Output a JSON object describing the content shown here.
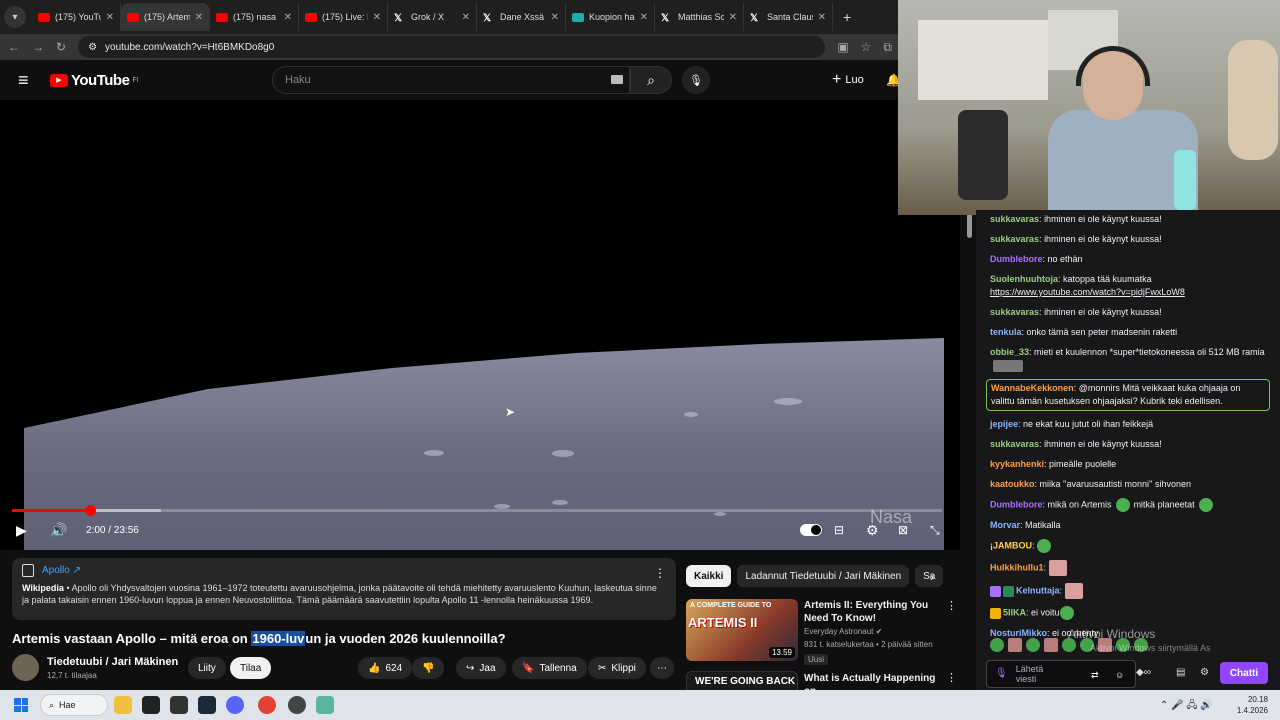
{
  "browser": {
    "tabs": [
      {
        "label": "(175) YouTu",
        "icon": "youtube-icon"
      },
      {
        "label": "(175) Artem",
        "icon": "youtube-icon",
        "active": true
      },
      {
        "label": "(175) nasa l",
        "icon": "youtube-icon"
      },
      {
        "label": "(175) Live: I",
        "icon": "youtube-icon"
      },
      {
        "label": "Grok / X",
        "icon": "x-icon"
      },
      {
        "label": "Dane Xssä",
        "icon": "x-icon"
      },
      {
        "label": "Kuopion ha",
        "icon": "kuopio-icon"
      },
      {
        "label": "Matthias Sc",
        "icon": "x-icon"
      },
      {
        "label": "Santa Claus",
        "icon": "x-icon"
      }
    ],
    "url": "youtube.com/watch?v=Ht6BMKDo8g0"
  },
  "youtube": {
    "logo_text": "YouTube",
    "region": "FI",
    "search_placeholder": "Haku",
    "create_label": "Luo"
  },
  "player": {
    "time": "2:00 / 23:56",
    "progress": 0.084,
    "buffered": 0.16,
    "watermark": "Nasa"
  },
  "info": {
    "title": "Apollo ↗",
    "source": "Wikipedia",
    "text": " • Apollo oli Yhdysvaltojen vuosina 1961–1972 toteutettu avaruusohjelma, jonka päätavoite oli tehdä miehitetty avaruuslento Kuuhun, laskeutua sinne ja palata takaisin ennen 1960-luvun loppua ja ennen Neuvostoliittoa. Tämä päämäärä saavutettiin lopulta Apollo 11 -lennolla heinäkuussa 1969."
  },
  "video": {
    "title_pre": "Artemis vastaan Apollo – mitä eroa on ",
    "title_hl": "1960-luv",
    "title_post": "un ja vuoden 2026 kuulennoilla?",
    "channel": "Tiedetuubi / Jari Mäkinen",
    "subscribers": "12,7 t. tilaajaa",
    "join": "Liity",
    "subscribe": "Tilaa",
    "likes": "624",
    "share": "Jaa",
    "save": "Tallenna",
    "clip": "Klippi"
  },
  "filters": [
    "Kaikki",
    "Ladannut Tiedetuubi / Jari Mäkinen",
    "Sa"
  ],
  "recommendations": [
    {
      "title": "Artemis II: Everything You Need To Know!",
      "channel": "Everyday Astronaut",
      "meta": "831 t. katselukertaa • 2 päivää sitten",
      "badge": "Uusi",
      "duration": "13.59",
      "thumb_top": "A COMPLETE GUIDE TO",
      "thumb_big": "ARTEMIS II"
    },
    {
      "title": "What is Actually Happening on",
      "thumb_text": "WE'RE GOING BACK"
    }
  ],
  "chat": {
    "messages": [
      {
        "user": "sukkavaras",
        "color": "#9acd80",
        "text": "ihminen ei ole käynyt kuussa!"
      },
      {
        "user": "sukkavaras",
        "color": "#9acd80",
        "text": "ihminen ei ole käynyt kuussa!"
      },
      {
        "user": "Dumblebore",
        "color": "#a970ff",
        "text": "no ethän"
      },
      {
        "user": "Suolenhuuhtoja",
        "color": "#9acd80",
        "text": "katoppa tää kuumatka",
        "link": "https://www.youtube.com/watch?v=pidjFwxLoW8"
      },
      {
        "user": "sukkavaras",
        "color": "#9acd80",
        "text": "ihminen ei ole käynyt kuussa!"
      },
      {
        "user": "tenkula",
        "color": "#8ab4f8",
        "text": "onko tämä sen peter madsenin raketti"
      },
      {
        "user": "obbie_33",
        "color": "#9acd80",
        "text": "mieti et kuulennon *super*tietokoneessa oli 512 MB ramia"
      },
      {
        "user": "WannabeKekkonen",
        "color": "#ff9f40",
        "text": "@monnirs Mitä veikkaat kuka ohjaaja on valittu tämän kusetuksen ohjaajaksi? Kubrik teki edellisen.",
        "highlight": true
      },
      {
        "user": "jepijee",
        "color": "#8ab4f8",
        "text": "ne ekat kuu jutut oli ihan feikkejä"
      },
      {
        "user": "sukkavaras",
        "color": "#9acd80",
        "text": "ihminen ei ole käynyt kuussa!"
      },
      {
        "user": "kyykanhenki",
        "color": "#ffa040",
        "text": "pimeälle puolelle"
      },
      {
        "user": "kaatoukko",
        "color": "#ff9f40",
        "text": "miika ''avaruusautisti monni'' sihvonen"
      },
      {
        "user": "Dumblebore",
        "color": "#a970ff",
        "text": "mikä on Artemis",
        "text2": "mitkä planeetat"
      },
      {
        "user": "Morvar",
        "color": "#8ab4f8",
        "text": "Matikalla"
      },
      {
        "user": "¡JAMBOU",
        "color": "#ffd24a",
        "text": ""
      },
      {
        "user": "Hulkkihullu1",
        "color": "#ff9f40",
        "text": ""
      },
      {
        "user": "Kelnuttaja",
        "color": "#8ab4f8",
        "text": ""
      },
      {
        "user": "5IIKA",
        "color": "#9acd80",
        "text": "ei voitu"
      },
      {
        "user": "NosturiMikko",
        "color": "#8ab4f8",
        "text": "ei oo menty"
      }
    ],
    "input_placeholder": "Lähetä viesti",
    "send_label": "Chatti",
    "activate_title": "Aktivoi Windows",
    "activate_sub": "Aktivoi Windows siirtymällä Asetuksiin."
  },
  "taskbar": {
    "search_label": "Hae",
    "time": "20.18",
    "date": "1.4.2026"
  }
}
